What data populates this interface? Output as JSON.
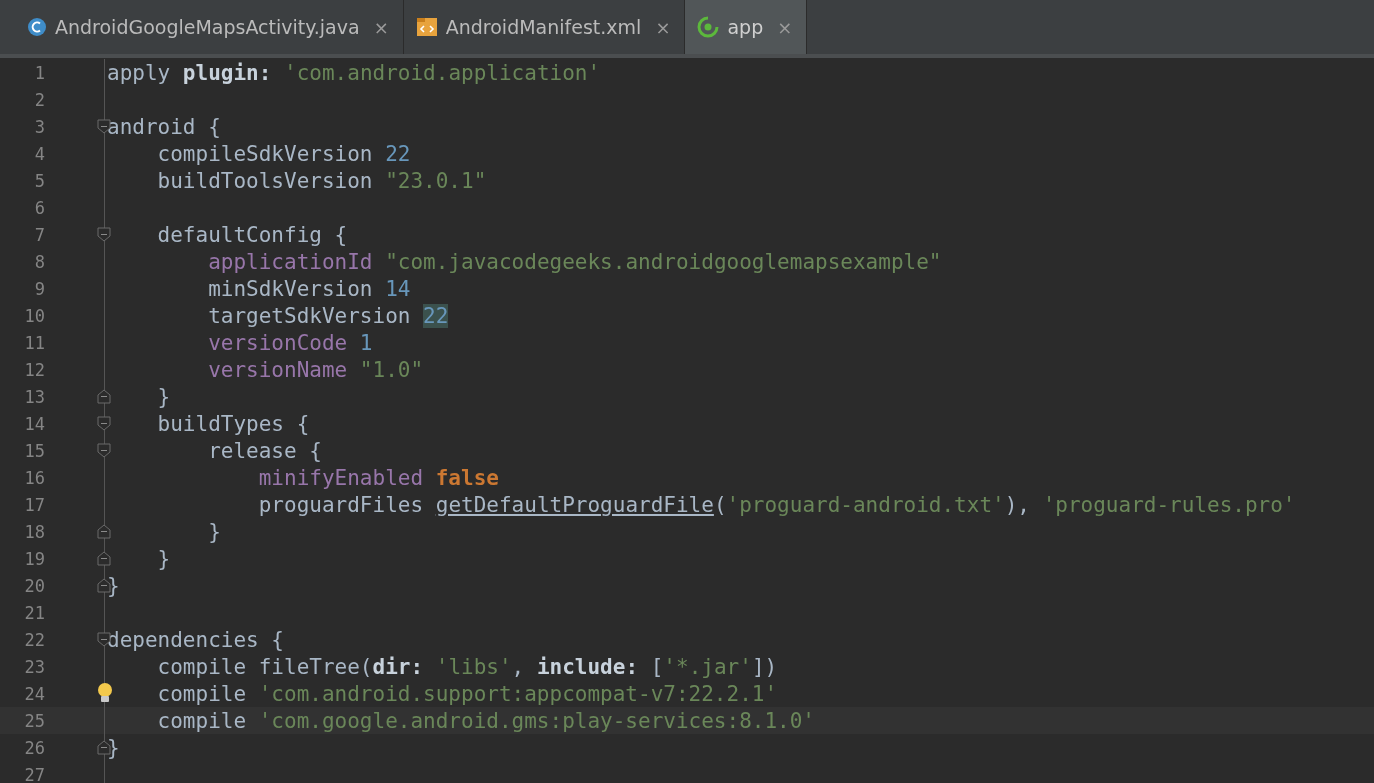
{
  "tabs": [
    {
      "kind": "class",
      "label": "AndroidGoogleMapsActivity.java",
      "close": "×",
      "selected": false
    },
    {
      "kind": "xml",
      "label": "AndroidManifest.xml",
      "close": "×",
      "selected": false
    },
    {
      "kind": "gradle",
      "label": "app",
      "close": "×",
      "selected": true
    }
  ],
  "editor": {
    "lines": [
      {
        "number": "1",
        "kind": "plain",
        "current": false,
        "hint": false,
        "segments": [
          {
            "kind": "plain",
            "text": "apply "
          },
          {
            "kind": "bold",
            "text": "plugin:"
          },
          {
            "kind": "string",
            "text": " 'com.android.application'"
          }
        ]
      },
      {
        "number": "2",
        "kind": "plain",
        "current": false,
        "hint": false
      },
      {
        "number": "3",
        "kind": "fold-start",
        "current": false,
        "hint": false,
        "segments": [
          {
            "kind": "plain",
            "text": "android {"
          }
        ]
      },
      {
        "number": "4",
        "kind": "plain",
        "current": false,
        "hint": false,
        "segments": [
          {
            "kind": "plain",
            "text": "    compileSdkVersion "
          },
          {
            "kind": "number",
            "text": "22"
          }
        ]
      },
      {
        "number": "5",
        "kind": "plain",
        "current": false,
        "hint": false,
        "segments": [
          {
            "kind": "plain",
            "text": "    buildToolsVersion "
          },
          {
            "kind": "string",
            "text": "\"23.0.1\""
          }
        ]
      },
      {
        "number": "6",
        "kind": "plain",
        "current": false,
        "hint": false
      },
      {
        "number": "7",
        "kind": "fold-start",
        "current": false,
        "hint": false,
        "segments": [
          {
            "kind": "plain",
            "text": "    defaultConfig {"
          }
        ]
      },
      {
        "number": "8",
        "kind": "plain",
        "current": false,
        "hint": false,
        "segments": [
          {
            "kind": "property",
            "text": "        applicationId"
          },
          {
            "kind": "string",
            "text": " \"com.javacodegeeks.androidgooglemapsexample\""
          }
        ]
      },
      {
        "number": "9",
        "kind": "plain",
        "current": false,
        "hint": false,
        "segments": [
          {
            "kind": "plain",
            "text": "        minSdkVersion "
          },
          {
            "kind": "number",
            "text": "14"
          }
        ]
      },
      {
        "number": "10",
        "kind": "plain",
        "current": false,
        "hint": false,
        "segments": [
          {
            "kind": "plain",
            "text": "        targetSdkVersion "
          },
          {
            "kind": "match",
            "text": "22"
          }
        ]
      },
      {
        "number": "11",
        "kind": "plain",
        "current": false,
        "hint": false,
        "segments": [
          {
            "kind": "property",
            "text": "        versionCode"
          },
          {
            "kind": "number",
            "text": " 1"
          }
        ]
      },
      {
        "number": "12",
        "kind": "plain",
        "current": false,
        "hint": false,
        "segments": [
          {
            "kind": "property",
            "text": "        versionName"
          },
          {
            "kind": "string",
            "text": " \"1.0\""
          }
        ]
      },
      {
        "number": "13",
        "kind": "fold-end",
        "current": false,
        "hint": false,
        "segments": [
          {
            "kind": "plain",
            "text": "    }"
          }
        ]
      },
      {
        "number": "14",
        "kind": "fold-start",
        "current": false,
        "hint": false,
        "segments": [
          {
            "kind": "plain",
            "text": "    buildTypes {"
          }
        ]
      },
      {
        "number": "15",
        "kind": "fold-start",
        "current": false,
        "hint": false,
        "segments": [
          {
            "kind": "plain",
            "text": "        release {"
          }
        ]
      },
      {
        "number": "16",
        "kind": "plain",
        "current": false,
        "hint": false,
        "segments": [
          {
            "kind": "property",
            "text": "            minifyEnabled"
          },
          {
            "kind": "keyword",
            "text": " false"
          }
        ]
      },
      {
        "number": "17",
        "kind": "plain",
        "current": false,
        "hint": false,
        "segments": [
          {
            "kind": "plain",
            "text": "            proguardFiles "
          },
          {
            "kind": "link",
            "text": "getDefaultProguardFile"
          },
          {
            "kind": "plain",
            "text": "("
          },
          {
            "kind": "string",
            "text": "'proguard-android.txt'"
          },
          {
            "kind": "plain",
            "text": "), "
          },
          {
            "kind": "string",
            "text": "'proguard-rules.pro'"
          }
        ]
      },
      {
        "number": "18",
        "kind": "fold-end",
        "current": false,
        "hint": false,
        "segments": [
          {
            "kind": "plain",
            "text": "        }"
          }
        ]
      },
      {
        "number": "19",
        "kind": "fold-end",
        "current": false,
        "hint": false,
        "segments": [
          {
            "kind": "plain",
            "text": "    }"
          }
        ]
      },
      {
        "number": "20",
        "kind": "fold-end",
        "current": false,
        "hint": false,
        "segments": [
          {
            "kind": "plain",
            "text": "}"
          }
        ]
      },
      {
        "number": "21",
        "kind": "plain",
        "current": false,
        "hint": false
      },
      {
        "number": "22",
        "kind": "fold-start",
        "current": false,
        "hint": false,
        "segments": [
          {
            "kind": "plain",
            "text": "dependencies {"
          }
        ]
      },
      {
        "number": "23",
        "kind": "plain",
        "current": false,
        "hint": false,
        "segments": [
          {
            "kind": "plain",
            "text": "    compile fileTree("
          },
          {
            "kind": "bold",
            "text": "dir:"
          },
          {
            "kind": "string",
            "text": " 'libs'"
          },
          {
            "kind": "plain",
            "text": ", "
          },
          {
            "kind": "bold",
            "text": "include:"
          },
          {
            "kind": "plain",
            "text": " ["
          },
          {
            "kind": "string",
            "text": "'*.jar'"
          },
          {
            "kind": "plain",
            "text": "])"
          }
        ]
      },
      {
        "number": "24",
        "kind": "plain",
        "current": false,
        "hint": true,
        "segments": [
          {
            "kind": "plain",
            "text": "    compile "
          },
          {
            "kind": "string",
            "text": "'com.android.support:appcompat-v7:22.2.1'"
          }
        ]
      },
      {
        "number": "25",
        "kind": "plain",
        "current": true,
        "hint": false,
        "segments": [
          {
            "kind": "plain",
            "text": "    compile "
          },
          {
            "kind": "string",
            "text": "'com.google.android.gms:play-services:8.1.0'"
          }
        ]
      },
      {
        "number": "26",
        "kind": "fold-end",
        "current": false,
        "hint": false,
        "segments": [
          {
            "kind": "plain",
            "text": "}"
          }
        ]
      },
      {
        "number": "27",
        "kind": "plain",
        "current": false,
        "hint": false
      }
    ]
  }
}
